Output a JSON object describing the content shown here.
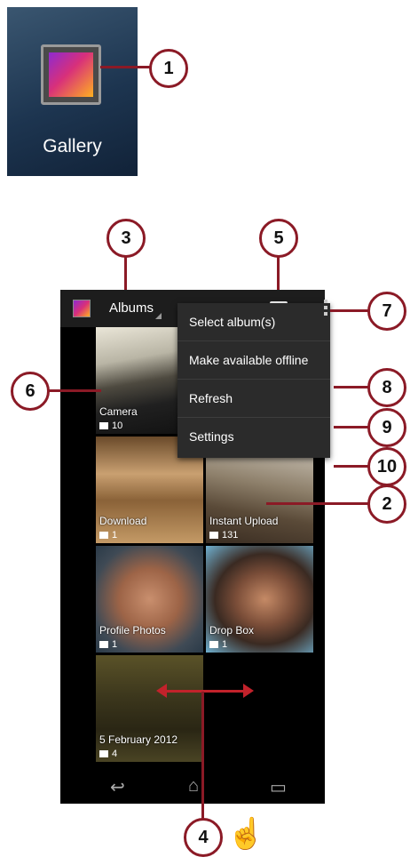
{
  "launcher": {
    "app_label": "Gallery"
  },
  "action_bar": {
    "title": "Albums"
  },
  "overflow_menu": {
    "items": [
      "Select album(s)",
      "Make available offline",
      "Refresh",
      "Settings"
    ]
  },
  "albums": [
    {
      "name": "Camera",
      "count": "10"
    },
    {
      "name": "Download",
      "count": "1"
    },
    {
      "name": "Instant Upload",
      "count": "131"
    },
    {
      "name": "Profile Photos",
      "count": "1"
    },
    {
      "name": "Drop Box",
      "count": "1"
    },
    {
      "name": "5 February 2012",
      "count": "4"
    }
  ],
  "callouts": [
    "1",
    "2",
    "3",
    "4",
    "5",
    "6",
    "7",
    "8",
    "9",
    "10"
  ],
  "colors": {
    "callout": "#8b1a26",
    "arrow": "#c2222b",
    "screen_bg": "#000000"
  }
}
